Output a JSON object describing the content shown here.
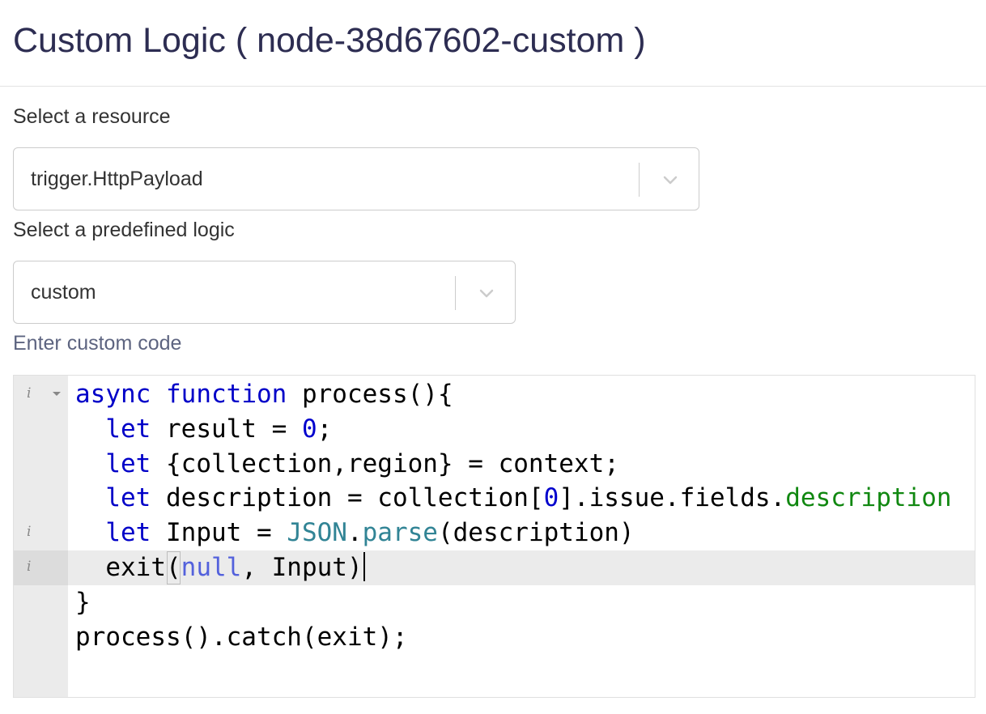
{
  "header": {
    "title": "Custom Logic ( node-38d67602-custom )"
  },
  "form": {
    "resource_label": "Select a resource",
    "resource_value": "trigger.HttpPayload",
    "logic_label": "Select a predefined logic",
    "logic_value": "custom",
    "code_label": "Enter custom code"
  },
  "editor": {
    "active_line": 6,
    "gutter_info_lines": [
      1,
      5,
      6
    ],
    "fold_lines": [
      1
    ],
    "lines": [
      "async function process(){",
      "  let result = 0;",
      "  let {collection,region} = context;",
      "  let description = collection[0].issue.fields.description",
      "  let Input = JSON.parse(description)",
      "  exit(null, Input)",
      "}",
      "process().catch(exit);"
    ]
  },
  "colors": {
    "title": "#2d2d52",
    "keyword": "#0000c8",
    "number": "#0000cd",
    "property": "#118811",
    "builtin": "#318495",
    "null": "#5361dc"
  },
  "icons": {
    "select_arrow": "chevron-down-icon",
    "gutter_info": "info-icon",
    "gutter_fold": "fold-arrow-icon"
  }
}
